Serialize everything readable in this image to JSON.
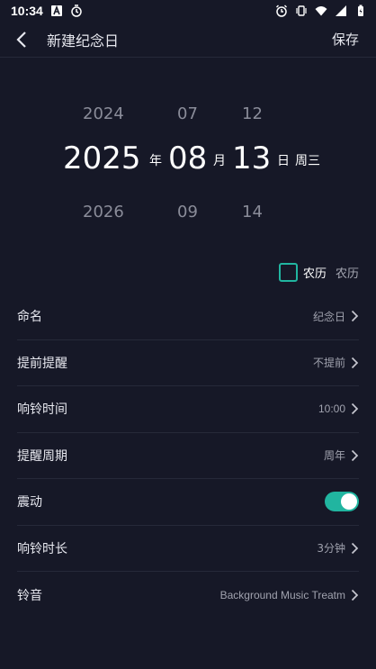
{
  "status_bar": {
    "time": "10:34",
    "left_icons": [
      "a-icon",
      "timer-icon"
    ],
    "right_icons": [
      "alarm-icon",
      "vibrate-icon",
      "wifi-icon",
      "signal-icon",
      "battery-icon"
    ]
  },
  "app_bar": {
    "title": "新建纪念日",
    "save_label": "保存"
  },
  "picker": {
    "prev": {
      "year": "2024",
      "month": "07",
      "day": "12"
    },
    "selected": {
      "year": "2025",
      "month": "08",
      "day": "13"
    },
    "next": {
      "year": "2026",
      "month": "09",
      "day": "14"
    },
    "units": {
      "year": "年",
      "month": "月",
      "day": "日"
    },
    "weekday": "周三"
  },
  "lunar": {
    "label": "农历",
    "value": "农历",
    "checked": false
  },
  "settings": {
    "name": {
      "label": "命名",
      "value": "纪念日"
    },
    "advance_reminder": {
      "label": "提前提醒",
      "value": "不提前"
    },
    "ring_time": {
      "label": "响铃时间",
      "value": "10:00"
    },
    "reminder_cycle": {
      "label": "提醒周期",
      "value": "周年"
    },
    "vibrate": {
      "label": "震动",
      "on": true
    },
    "ring_duration": {
      "label": "响铃时长",
      "value": "3分钟"
    },
    "ringtone": {
      "label": "铃音",
      "value": "Background Music Treatm"
    }
  },
  "colors": {
    "background": "#161827",
    "accent": "#21b5a0",
    "divider": "#262939",
    "secondary_text": "#a0a2ae"
  }
}
